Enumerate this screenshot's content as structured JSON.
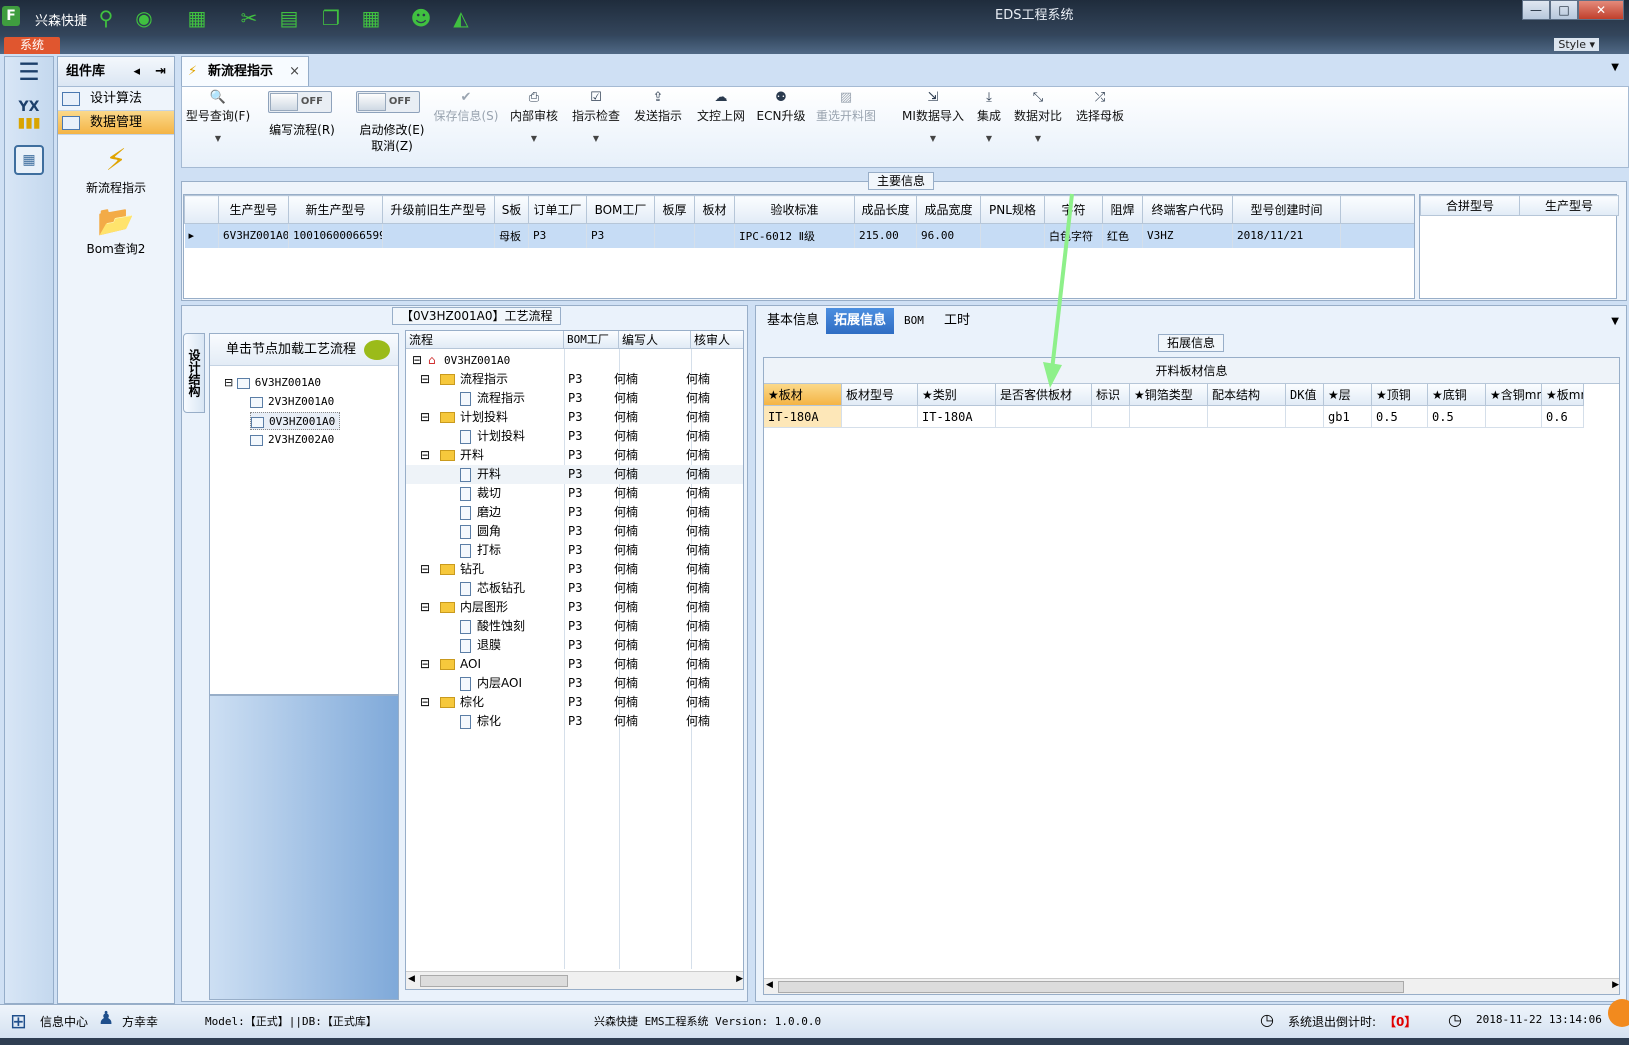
{
  "titlebar": {
    "quick_label": "兴森快捷",
    "window_title": "EDS工程系统",
    "minimize": "—",
    "maximize": "□",
    "close": "✕"
  },
  "menu": {
    "system": "系统",
    "style": "Style ▾"
  },
  "component_lib": {
    "title": "组件库",
    "items": [
      {
        "label": "设计算法",
        "active": false
      },
      {
        "label": "数据管理",
        "active": true
      }
    ],
    "big_items": [
      {
        "label": "新流程指示",
        "icon": "lightning-icon"
      },
      {
        "label": "Bom查询2",
        "icon": "folder-open-icon"
      }
    ]
  },
  "doc_tab": {
    "label": "新流程指示",
    "close": "×"
  },
  "toolbar": {
    "model_query": "型号查询(F)",
    "edit_flow": "编写流程(R)",
    "start_modify": "启动修改(E)",
    "cancel": "取消(Z)",
    "toggle_off": "OFF",
    "save_info": "保存信息(S)",
    "internal_review": "内部审核",
    "guide_check": "指示检查",
    "send_guide": "发送指示",
    "doc_upload": "文控上网",
    "ecn_upgrade": "ECN升级",
    "reselect_chart": "重选开料图",
    "mi_import": "MI数据导入",
    "integrate": "集成",
    "data_compare": "数据对比",
    "select_board": "选择母板"
  },
  "main_info": {
    "title": "主要信息",
    "columns": [
      "生产型号",
      "新生产型号",
      "升级前旧生产型号",
      "S板",
      "订单工厂",
      "BOM工厂",
      "板厚",
      "板材",
      "验收标准",
      "成品长度",
      "成品宽度",
      "PNL规格",
      "字符",
      "阻焊",
      "终端客户代码",
      "型号创建时间"
    ],
    "row": [
      "6V3HZ001A0",
      "10010600066599",
      "",
      "母板",
      "P3",
      "P3",
      "",
      "",
      "IPC-6012 Ⅱ级",
      "215.00",
      "96.00",
      "",
      "白色字符",
      "红色",
      "V3HZ",
      "2018/11/21"
    ],
    "side_columns": [
      "合拼型号",
      "生产型号"
    ]
  },
  "process": {
    "title": "【0V3HZ001A0】工艺流程",
    "vtab": "设计结构",
    "load_hint": "单击节点加载工艺流程",
    "tree": [
      {
        "label": "6V3HZ001A0",
        "level": 0,
        "selected": false
      },
      {
        "label": "2V3HZ001A0",
        "level": 1,
        "selected": false
      },
      {
        "label": "0V3HZ001A0",
        "level": 1,
        "selected": true
      },
      {
        "label": "2V3HZ002A0",
        "level": 1,
        "selected": false
      }
    ],
    "grid_columns": [
      "流程",
      "BOM工厂",
      "编写人",
      "核审人"
    ],
    "root": "0V3HZ001A0",
    "rows": [
      {
        "name": "流程指示",
        "kind": "folder",
        "factory": "P3",
        "writer": "何楠",
        "reviewer": "何楠"
      },
      {
        "name": "流程指示",
        "kind": "doc",
        "factory": "P3",
        "writer": "何楠",
        "reviewer": "何楠"
      },
      {
        "name": "计划投料",
        "kind": "folder",
        "factory": "P3",
        "writer": "何楠",
        "reviewer": "何楠"
      },
      {
        "name": "计划投料",
        "kind": "doc",
        "factory": "P3",
        "writer": "何楠",
        "reviewer": "何楠"
      },
      {
        "name": "开料",
        "kind": "folder",
        "factory": "P3",
        "writer": "何楠",
        "reviewer": "何楠"
      },
      {
        "name": "开料",
        "kind": "doc",
        "factory": "P3",
        "writer": "何楠",
        "reviewer": "何楠",
        "selected": true
      },
      {
        "name": "裁切",
        "kind": "doc",
        "factory": "P3",
        "writer": "何楠",
        "reviewer": "何楠"
      },
      {
        "name": "磨边",
        "kind": "doc",
        "factory": "P3",
        "writer": "何楠",
        "reviewer": "何楠"
      },
      {
        "name": "圆角",
        "kind": "doc",
        "factory": "P3",
        "writer": "何楠",
        "reviewer": "何楠"
      },
      {
        "name": "打标",
        "kind": "doc",
        "factory": "P3",
        "writer": "何楠",
        "reviewer": "何楠"
      },
      {
        "name": "钻孔",
        "kind": "folder",
        "factory": "P3",
        "writer": "何楠",
        "reviewer": "何楠"
      },
      {
        "name": "芯板钻孔",
        "kind": "doc",
        "factory": "P3",
        "writer": "何楠",
        "reviewer": "何楠"
      },
      {
        "name": "内层图形",
        "kind": "folder",
        "factory": "P3",
        "writer": "何楠",
        "reviewer": "何楠"
      },
      {
        "name": "酸性蚀刻",
        "kind": "doc",
        "factory": "P3",
        "writer": "何楠",
        "reviewer": "何楠"
      },
      {
        "name": "退膜",
        "kind": "doc",
        "factory": "P3",
        "writer": "何楠",
        "reviewer": "何楠"
      },
      {
        "name": "AOI",
        "kind": "folder",
        "factory": "P3",
        "writer": "何楠",
        "reviewer": "何楠"
      },
      {
        "name": "内层AOI",
        "kind": "doc",
        "factory": "P3",
        "writer": "何楠",
        "reviewer": "何楠"
      },
      {
        "name": "棕化",
        "kind": "folder",
        "factory": "P3",
        "writer": "何楠",
        "reviewer": "何楠"
      },
      {
        "name": "棕化",
        "kind": "doc",
        "factory": "P3",
        "writer": "何楠",
        "reviewer": "何楠"
      }
    ]
  },
  "right_tabs": [
    "基本信息",
    "拓展信息",
    "BOM",
    "工时"
  ],
  "ext_info": {
    "title": "拓展信息",
    "caption": "开料板材信息",
    "columns": [
      "★板材",
      "板材型号",
      "★类别",
      "是否客供板材",
      "标识",
      "★铜箔类型",
      "配本结构",
      "DK值",
      "★层",
      "★顶铜",
      "★底铜",
      "★含铜mm",
      "★板mm"
    ],
    "row": [
      "IT-180A",
      "",
      "IT-180A",
      "",
      "",
      "",
      "",
      "",
      "gb1",
      "0.5",
      "0.5",
      "",
      "0.6"
    ]
  },
  "statusbar": {
    "info_center": "信息中心",
    "user": "方幸幸",
    "model_db": "Model:【正式】||DB:【正式库】",
    "version": "兴森快捷 EMS工程系统 Version: 1.0.0.0",
    "countdown_label": "系统退出倒计时:",
    "countdown_value": "【0】",
    "datetime": "2018-11-22 13:14:06"
  }
}
